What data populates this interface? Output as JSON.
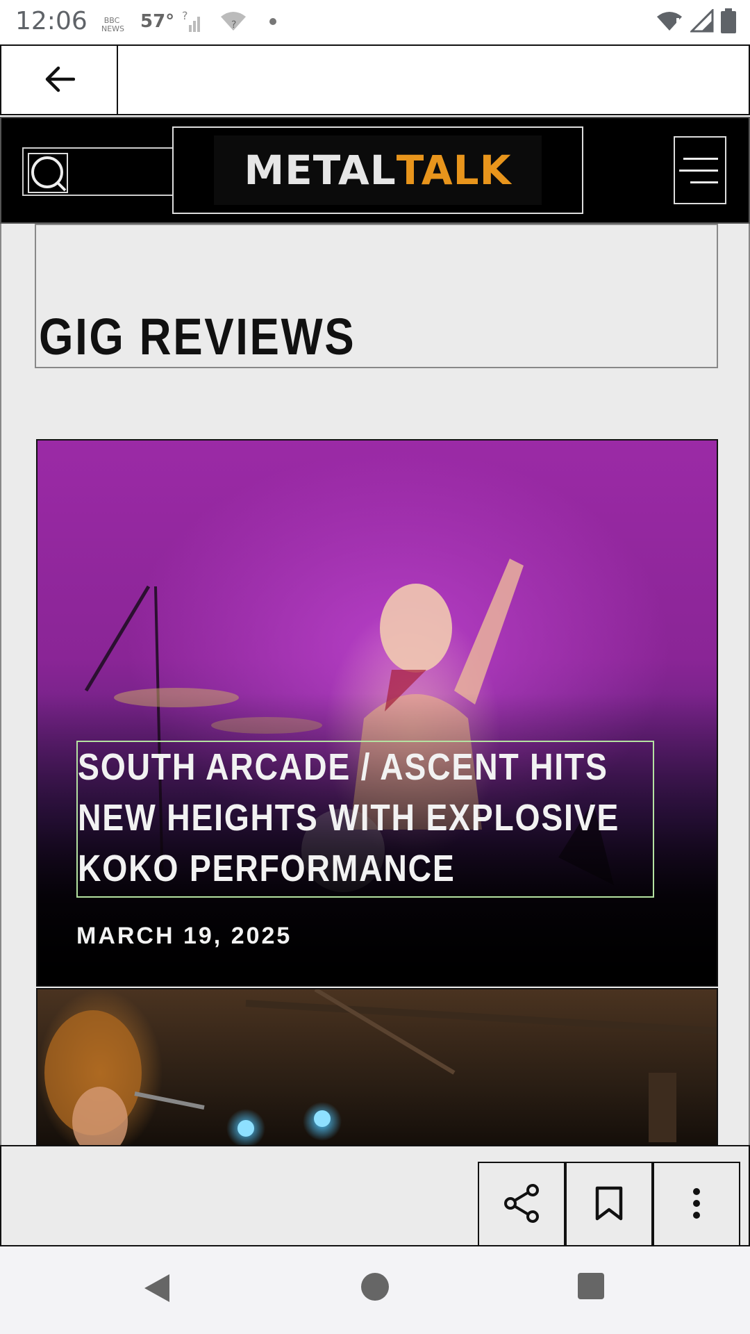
{
  "status_bar": {
    "time": "12:06",
    "news_label": "BBC NEWS",
    "temperature": "57°"
  },
  "browser": {
    "back_icon": "arrow-left-icon"
  },
  "site_header": {
    "logo_part1": "METAL",
    "logo_part2": "TALK",
    "logo_colors": {
      "metal": "#e6e6e6",
      "talk": "#e8951c"
    },
    "search_icon": "search-icon",
    "menu_icon": "hamburger-menu-icon"
  },
  "page": {
    "section_title": "GIG REVIEWS",
    "articles": [
      {
        "headline": "SOUTH ARCADE / ASCENT HITS NEW HEIGHTS WITH EXPLOSIVE KOKO PERFORMANCE",
        "date": "MARCH 19, 2025"
      }
    ]
  },
  "toolbar": {
    "share_icon": "share-icon",
    "bookmark_icon": "bookmark-icon",
    "more_icon": "more-vertical-icon"
  },
  "android_nav": {
    "back": "nav-back-icon",
    "home": "nav-home-icon",
    "recents": "nav-recents-icon"
  }
}
